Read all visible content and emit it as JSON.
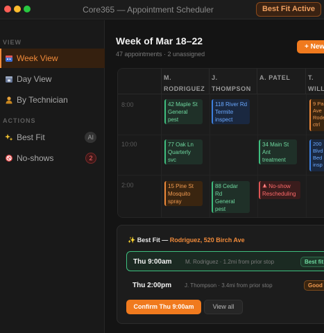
{
  "window": {
    "title": "Core365 — Appointment Scheduler",
    "mode_badge": "Best Fit Active"
  },
  "sidebar": {
    "view_label": "VIEW",
    "view_items": [
      {
        "label": "Week View",
        "icon": "calendar-icon",
        "active": true
      },
      {
        "label": "Day View",
        "icon": "calendar-day-icon",
        "active": false
      },
      {
        "label": "By Technician",
        "icon": "person-icon",
        "active": false
      }
    ],
    "actions_label": "ACTIONS",
    "action_items": [
      {
        "label": "Best Fit",
        "icon": "sparkles-icon",
        "badge": "AI"
      },
      {
        "label": "No-shows",
        "icon": "no-show-icon",
        "badge": "2"
      }
    ]
  },
  "header": {
    "title": "Week of Mar 18–22",
    "subtitle": "47 appointments · 2 unassigned",
    "new_button": "+ New"
  },
  "calendar": {
    "columns": [
      "M.\nRODRIGUEZ",
      "J.\nTHOMPSON",
      "A. PATEL",
      "T.\nWILL"
    ],
    "times": [
      "8:00",
      "10:00",
      "2:00"
    ],
    "appointments": {
      "a1": "42 Maple St\nGeneral\npest",
      "a2": "118 River Rd\nTermite\ninspect",
      "a3": "9 Pa\nAve\nRode\nctrl",
      "a4": "77 Oak Ln\nQuarterly\nsvc",
      "a5": "34 Main St\nAnt\ntreatment",
      "a6": "200\nBlvd\nBed\ninsp",
      "a7": "15 Pine St\nMosquito\nspray",
      "a8": "88 Cedar\nRd\nGeneral\npest",
      "a9_title": "No-show",
      "a9_sub": "Rescheduling"
    }
  },
  "best_fit": {
    "heading_prefix": "✨ Best Fit — ",
    "heading_tech": "Rodriguez, 520 Birch Ave",
    "slots": [
      {
        "time": "Thu 9:00am",
        "info": "M. Rodriguez · 1.2mi from prior stop",
        "chip": "Best fit"
      },
      {
        "time": "Thu 2:00pm",
        "info": "J. Thompson · 3.4mi from prior stop",
        "chip": "Good"
      }
    ],
    "confirm_button": "Confirm Thu 9:00am",
    "view_all_button": "View all"
  },
  "colors": {
    "accent": "#f07a1e",
    "success": "#3fbf7f",
    "info": "#3d80e0",
    "danger": "#e05555"
  }
}
